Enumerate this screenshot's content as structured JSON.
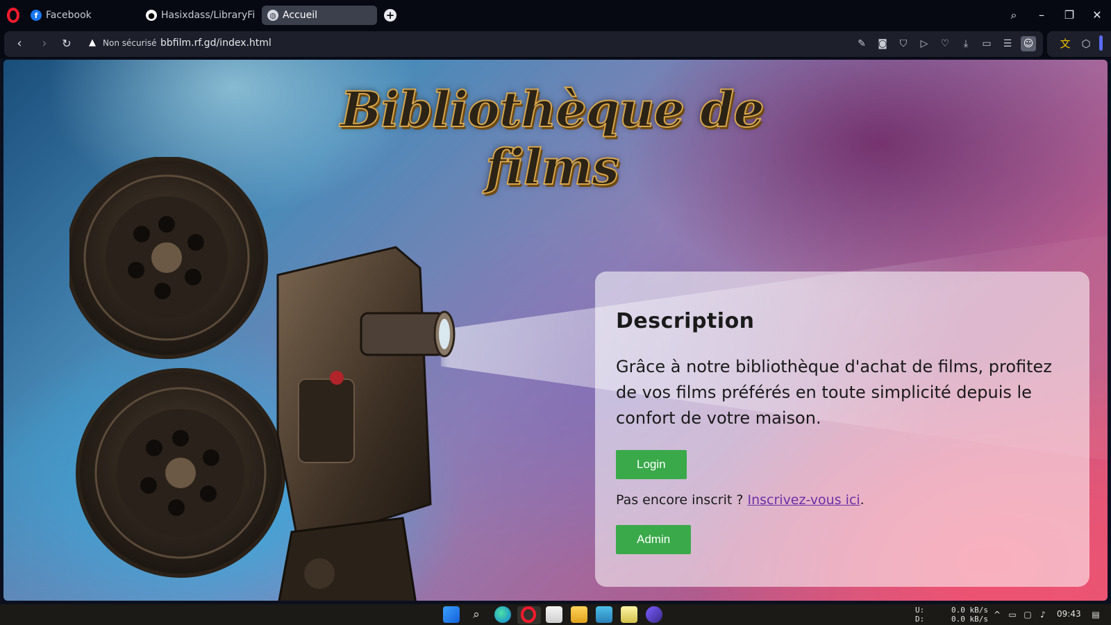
{
  "browser": {
    "tabs": [
      {
        "label": "Facebook",
        "favicon": "facebook-icon",
        "active": false
      },
      {
        "label": "Hasixdass/LibraryFilm",
        "favicon": "github-icon",
        "active": false
      },
      {
        "label": "Accueil",
        "favicon": "globe-icon",
        "active": true
      }
    ],
    "security_text": "Non sécurisé",
    "url": "bbfilm.rf.gd/index.html"
  },
  "page": {
    "site_title": "Bibliothèque de films",
    "card": {
      "heading": "Description",
      "description": "Grâce à notre bibliothèque d'achat de films, profitez de vos films préférés en toute simplicité depuis le confort de votre maison.",
      "login_label": "Login",
      "signup_prompt": "Pas encore inscrit ? ",
      "signup_link": "Inscrivez-vous ici",
      "signup_suffix": ".",
      "admin_label": "Admin"
    }
  },
  "taskbar": {
    "upload_label": "U:",
    "download_label": "D:",
    "upload_speed": "0.0 kB/s",
    "download_speed": "0.0 kB/s",
    "time": "09:43"
  },
  "colors": {
    "button": "#3aa94a",
    "link": "#6b2fa8",
    "opera_red": "#ff1b2d",
    "title_gold": "#d9a64a"
  }
}
